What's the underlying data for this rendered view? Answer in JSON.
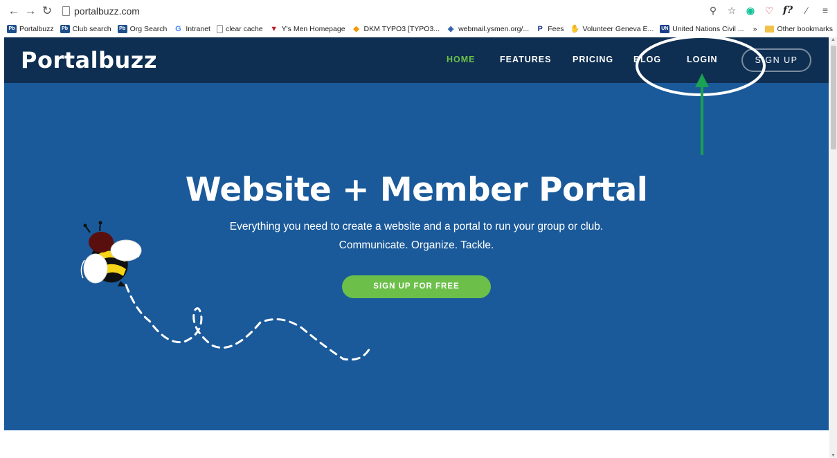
{
  "browser": {
    "url": "portalbuzz.com",
    "bookmarks": [
      {
        "label": "Portalbuzz",
        "icon": "pb-icon"
      },
      {
        "label": "Club search",
        "icon": "pb-icon"
      },
      {
        "label": "Org Search",
        "icon": "pb-icon"
      },
      {
        "label": "Intranet",
        "icon": "google-icon"
      },
      {
        "label": "clear cache",
        "icon": "page-icon"
      },
      {
        "label": "Y's Men Homepage",
        "icon": "ysmen-icon"
      },
      {
        "label": "DKM TYPO3 [TYPO3...",
        "icon": "typo3-icon"
      },
      {
        "label": "webmail.ysmen.org/...",
        "icon": "webmail-icon"
      },
      {
        "label": "Fees",
        "icon": "paypal-icon"
      },
      {
        "label": "Volunteer Geneva E...",
        "icon": "volunteer-icon"
      },
      {
        "label": "United Nations Civil ...",
        "icon": "un-icon"
      }
    ],
    "more_bookmarks": "»",
    "other_bookmarks": "Other bookmarks"
  },
  "site": {
    "logo": "Portalbuzz",
    "nav": {
      "home": "HOME",
      "features": "FEATURES",
      "pricing": "PRICING",
      "blog": "BLOG",
      "login": "LOGIN",
      "signup": "SIGN UP"
    },
    "hero": {
      "title": "Website + Member Portal",
      "subtitle_line1": "Everything you need to create a website and a portal to run your group or club.",
      "subtitle_line2": "Communicate. Organize. Tackle.",
      "cta": "SIGN UP FOR FREE"
    }
  },
  "colors": {
    "nav_bg": "#0e2f52",
    "hero_bg": "#1a5a9a",
    "accent_green": "#6cc04a",
    "annotation_arrow": "#1aa152"
  }
}
